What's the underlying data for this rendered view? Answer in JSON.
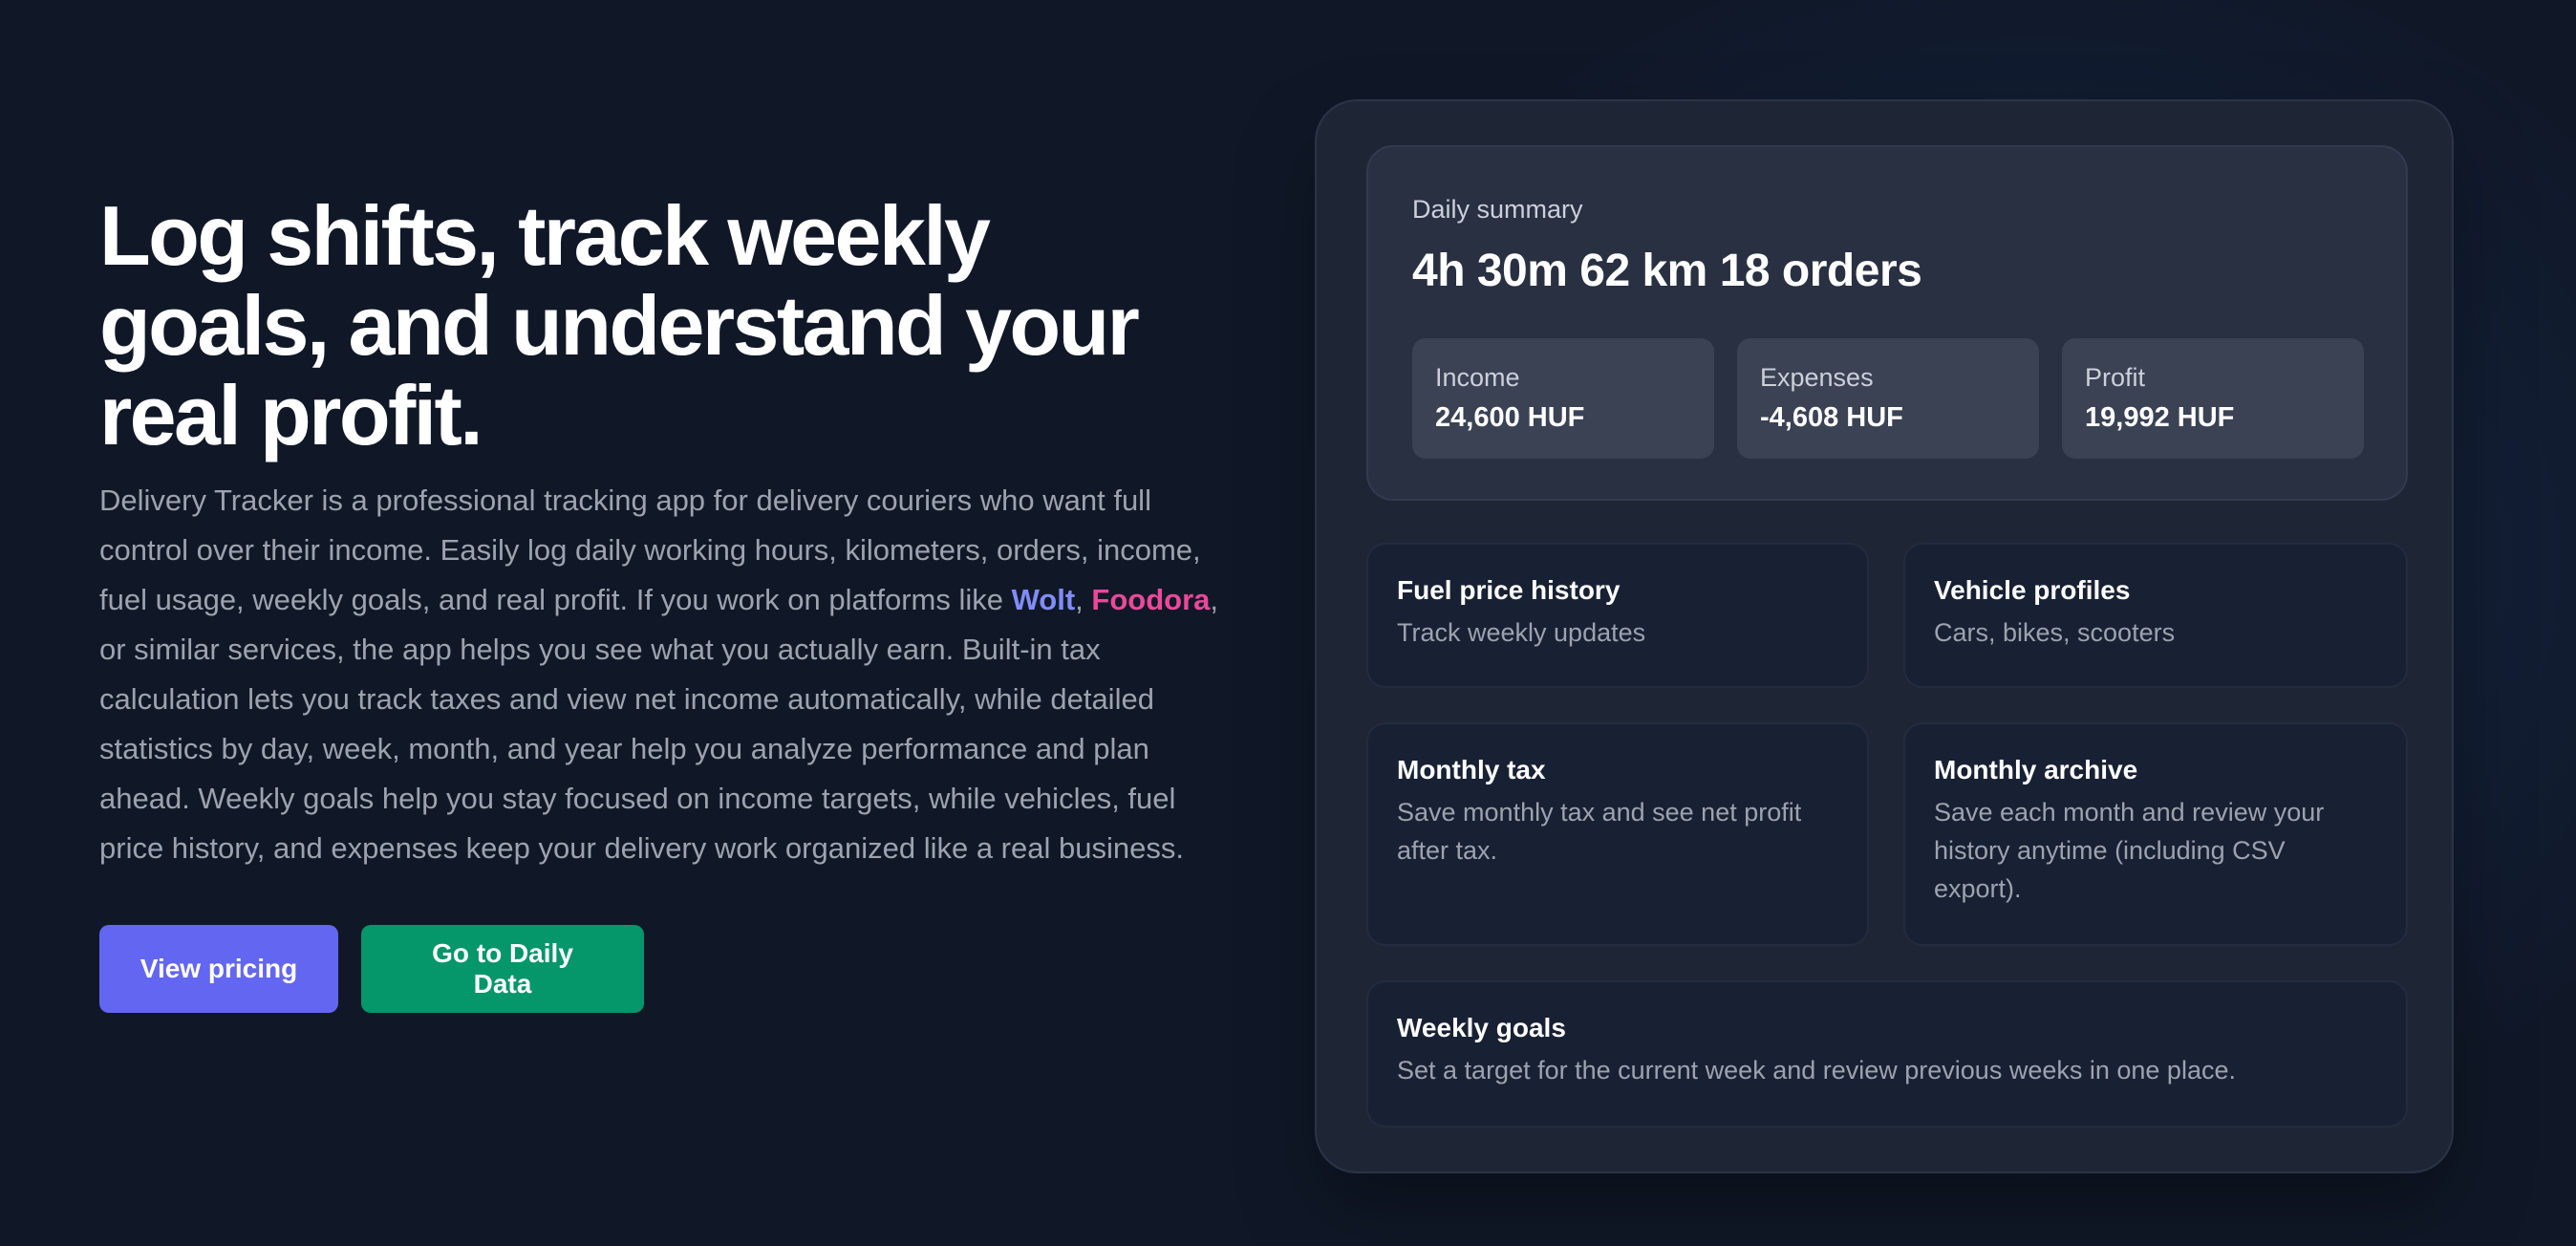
{
  "hero": {
    "headline": "Log shifts, track weekly goals, and understand your real profit.",
    "description_part1": "Delivery Tracker is a professional tracking app for delivery couriers who want full control over their income. Easily log daily working hours, kilometers, orders, income, fuel usage, weekly goals, and real profit. If you work on platforms like ",
    "platform_wolt": "Wolt",
    "separator": ", ",
    "platform_foodora": "Foodora",
    "description_part2": ", or similar services, the app helps you see what you actually earn. Built-in tax calculation lets you track taxes and view net income automatically, while detailed statistics by day, week, month, and year help you analyze performance and plan ahead. Weekly goals help you stay focused on income targets, while vehicles, fuel price history, and expenses keep your delivery work organized like a real business.",
    "buttons": {
      "pricing": "View pricing",
      "daily_data": "Go to Daily Data"
    }
  },
  "summary": {
    "label": "Daily summary",
    "value": "4h 30m 62 km 18 orders",
    "stats": [
      {
        "label": "Income",
        "value": "24,600 HUF"
      },
      {
        "label": "Expenses",
        "value": "-4,608 HUF"
      },
      {
        "label": "Profit",
        "value": "19,992 HUF"
      }
    ]
  },
  "features": [
    {
      "title": "Fuel price history",
      "text": "Track weekly updates"
    },
    {
      "title": "Vehicle profiles",
      "text": "Cars, bikes, scooters"
    },
    {
      "title": "Monthly tax",
      "text": "Save monthly tax and see net profit after tax."
    },
    {
      "title": "Monthly archive",
      "text": "Save each month and review your history anytime (including CSV export)."
    },
    {
      "title": "Weekly goals",
      "text": "Set a target for the current week and review previous weeks in one place."
    }
  ],
  "colors": {
    "background": "#101828",
    "primary": "#6366f1",
    "success": "#059669",
    "wolt": "#818cf8",
    "foodora": "#ec4899"
  }
}
